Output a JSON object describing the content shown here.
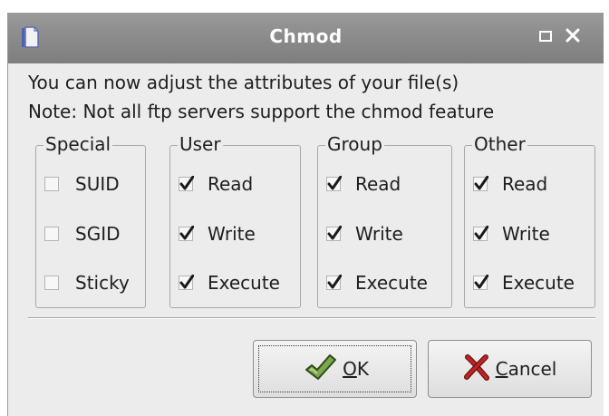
{
  "window": {
    "title": "Chmod",
    "icons": {
      "app": "document-icon",
      "maximize": "maximize-icon",
      "close": "close-icon"
    }
  },
  "message": {
    "line1": "You can now adjust the attributes of your file(s)",
    "line2": "Note: Not all ftp servers support the chmod feature"
  },
  "groups": {
    "special": {
      "label": "Special",
      "items": [
        {
          "label": "SUID",
          "checked": false
        },
        {
          "label": "SGID",
          "checked": false
        },
        {
          "label": "Sticky",
          "checked": false
        }
      ]
    },
    "user": {
      "label": "User",
      "items": [
        {
          "label": "Read",
          "checked": true
        },
        {
          "label": "Write",
          "checked": true
        },
        {
          "label": "Execute",
          "checked": true
        }
      ]
    },
    "group": {
      "label": "Group",
      "items": [
        {
          "label": "Read",
          "checked": true
        },
        {
          "label": "Write",
          "checked": true
        },
        {
          "label": "Execute",
          "checked": true
        }
      ]
    },
    "other": {
      "label": "Other",
      "items": [
        {
          "label": "Read",
          "checked": true
        },
        {
          "label": "Write",
          "checked": true
        },
        {
          "label": "Execute",
          "checked": true
        }
      ]
    }
  },
  "buttons": {
    "ok": {
      "mnemonic": "O",
      "rest": "K",
      "icon": "ok-check-icon"
    },
    "cancel": {
      "mnemonic": "C",
      "rest": "ancel",
      "icon": "cancel-x-icon"
    }
  },
  "colors": {
    "titlebar": "#8c8c8c",
    "dialog_bg": "#ececec",
    "cancel_icon": "#b02020",
    "ok_icon": "#6a9a3a"
  }
}
